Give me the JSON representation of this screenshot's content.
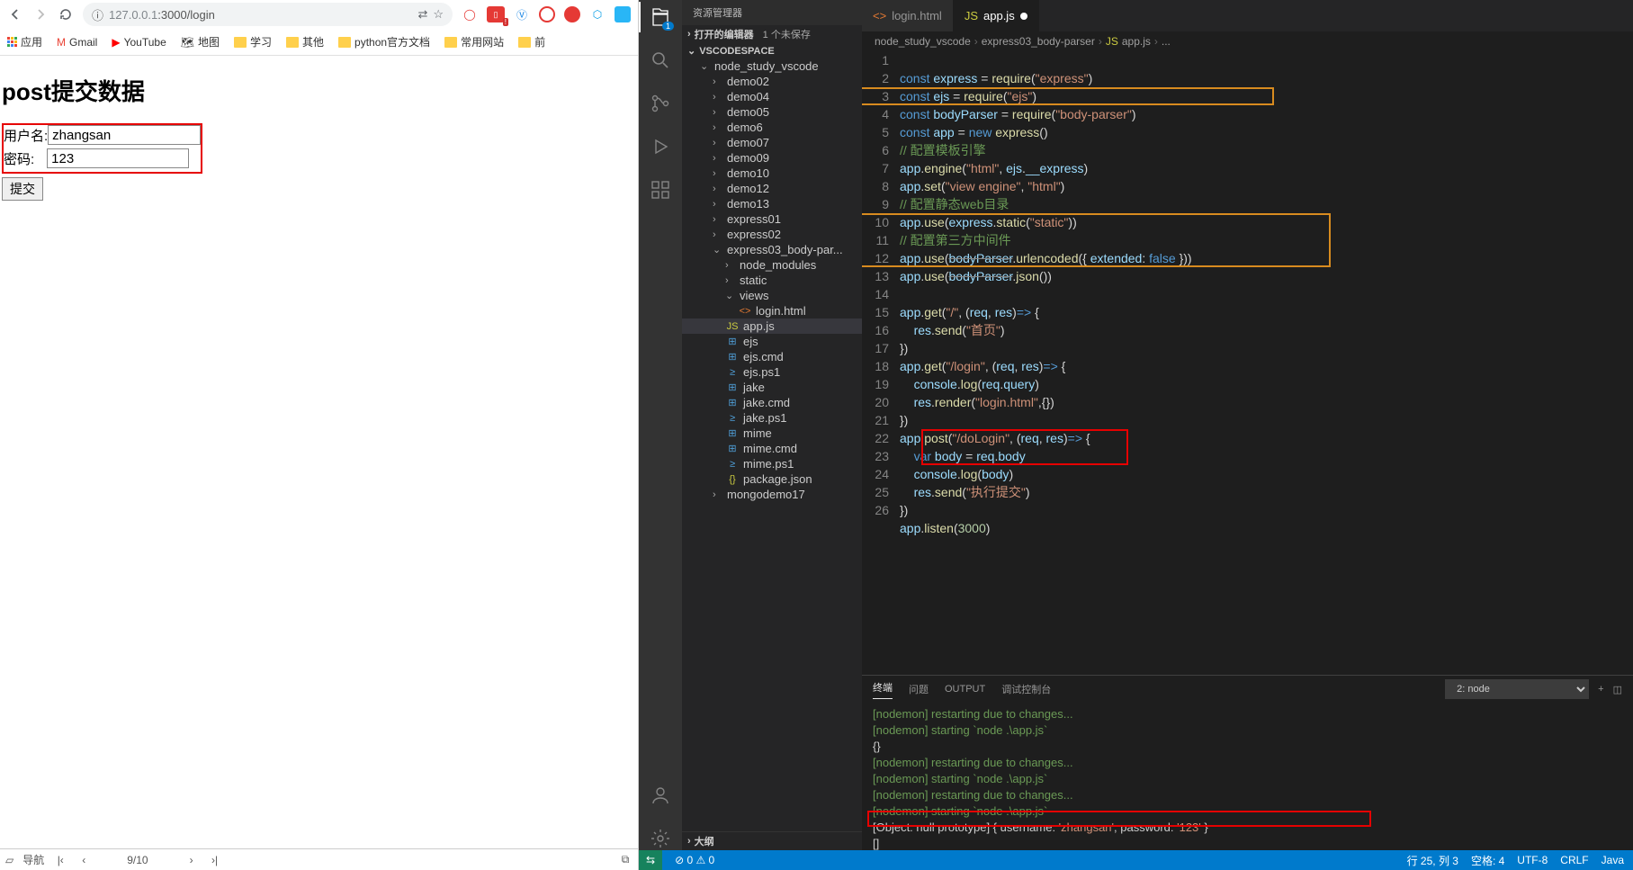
{
  "browser": {
    "url_prefix": "127.0.0.1",
    "url_path": ":3000/login",
    "info_icon": "ⓘ",
    "bookmarks": {
      "apps": "应用",
      "gmail": "Gmail",
      "youtube": "YouTube",
      "maps": "地图",
      "study": "学习",
      "other": "其他",
      "python": "python官方文档",
      "common": "常用网站",
      "front": "前"
    }
  },
  "page": {
    "heading": "post提交数据",
    "username_label": "用户名:",
    "username_value": "zhangsan",
    "password_label": "密码:",
    "password_value": "123",
    "submit": "提交"
  },
  "pager": {
    "nav": "导航",
    "pos": "9/10"
  },
  "vscode": {
    "explorer_title": "资源管理器",
    "open_editors": "打开的编辑器",
    "unsaved": "1 个未保存",
    "workspace": "VSCODESPACE",
    "outline": "大纲",
    "tree": {
      "root": "node_study_vscode",
      "demos": [
        "demo02",
        "demo04",
        "demo05",
        "demo6",
        "demo07",
        "demo09",
        "demo10",
        "demo12",
        "demo13"
      ],
      "express": [
        "express01",
        "express02"
      ],
      "express03": "express03_body-par...",
      "node_modules": "node_modules",
      "static": "static",
      "views": "views",
      "login_html": "login.html",
      "files": [
        "app.js",
        "ejs",
        "ejs.cmd",
        "ejs.ps1",
        "jake",
        "jake.cmd",
        "jake.ps1",
        "mime",
        "mime.cmd",
        "mime.ps1",
        "package.json"
      ],
      "mongo": "mongodemo17"
    },
    "tabs": {
      "login": "login.html",
      "app": "app.js"
    },
    "breadcrumb": {
      "p1": "node_study_vscode",
      "p2": "express03_body-parser",
      "p3": "app.js",
      "p4": "..."
    },
    "code": {
      "l1": "const express = require(\"express\")",
      "l2": "const ejs = require(\"ejs\")",
      "l3": "const bodyParser = require(\"body-parser\")",
      "l4": "const app = new express()",
      "l5": "// 配置模板引擎",
      "l6": "app.engine(\"html\", ejs.__express)",
      "l7": "app.set(\"view engine\", \"html\")",
      "l8": "// 配置静态web目录",
      "l9": "app.use(express.static(\"static\"))",
      "l10": "// 配置第三方中间件",
      "l11": "app.use(bodyParser.urlencoded({ extended: false }))",
      "l12": "app.use(bodyParser.json())",
      "l14": "app.get(\"/\", (req, res)=> {",
      "l15": "    res.send(\"首页\")",
      "l16": "})",
      "l17": "app.get(\"/login\", (req, res)=> {",
      "l18": "    console.log(req.query)",
      "l19": "    res.render(\"login.html\",{})",
      "l20": "})",
      "l21": "app.post(\"/doLogin\", (req, res)=> {",
      "l22": "    var body = req.body",
      "l23": "    console.log(body)",
      "l24": "    res.send(\"执行提交\")",
      "l25": "})",
      "l26": "app.listen(3000)"
    },
    "terminal": {
      "tabs": {
        "t1": "终端",
        "t2": "问题",
        "t3": "OUTPUT",
        "t4": "调试控制台"
      },
      "selector": "2: node",
      "lines": [
        "[nodemon] restarting due to changes...",
        "[nodemon] starting `node .\\app.js`",
        "{}",
        "[nodemon] restarting due to changes...",
        "[nodemon] starting `node .\\app.js`",
        "[nodemon] restarting due to changes...",
        "[nodemon] starting `node .\\app.js`"
      ],
      "result_pre": "[Object: null prototype] { username: ",
      "result_u": "'zhangsan'",
      "result_mid": ", password: ",
      "result_p": "'123'",
      "result_end": " }",
      "cursor": "[]"
    },
    "status": {
      "remote": "⟲",
      "errs": "⊘ 0 ⚠ 0",
      "pos": "行 25, 列 3",
      "spaces": "空格: 4",
      "enc": "UTF-8",
      "eol": "CRLF",
      "lang": "Java"
    }
  }
}
